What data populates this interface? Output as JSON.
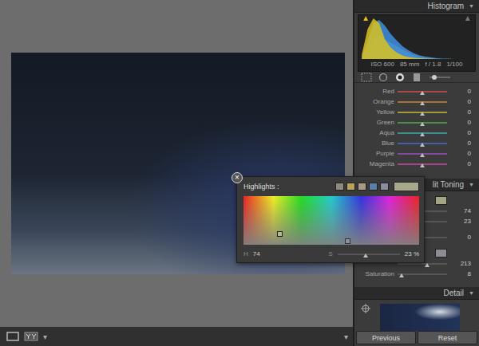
{
  "histogram": {
    "title": "Histogram",
    "toggle": "▼",
    "info": [
      "ISO 600",
      "85 mm",
      "f / 1.8",
      "1/100"
    ],
    "series": [
      {
        "name": "gray",
        "color": "#8e8e8e",
        "values": [
          2,
          22,
          52,
          58,
          48,
          40,
          32,
          24,
          16,
          10,
          6,
          4,
          2,
          1,
          0,
          0,
          0,
          0,
          0,
          0
        ]
      },
      {
        "name": "blue",
        "color": "#3d8fe0",
        "values": [
          6,
          45,
          88,
          96,
          82,
          62,
          46,
          32,
          22,
          14,
          9,
          6,
          4,
          2,
          1,
          1,
          0,
          0,
          0,
          0
        ]
      },
      {
        "name": "yellow",
        "color": "#d9c222",
        "values": [
          12,
          74,
          100,
          88,
          48,
          28,
          16,
          9,
          5,
          3,
          2,
          1,
          1,
          0,
          0,
          0,
          0,
          0,
          0,
          0
        ]
      }
    ]
  },
  "hsl": [
    {
      "label": "Red",
      "value": "0",
      "level": 0.5,
      "color": "#b84a4a"
    },
    {
      "label": "Orange",
      "value": "0",
      "level": 0.5,
      "color": "#b8793a"
    },
    {
      "label": "Yellow",
      "value": "0",
      "level": 0.5,
      "color": "#b0a43a"
    },
    {
      "label": "Green",
      "value": "0",
      "level": 0.5,
      "color": "#4e9a4a"
    },
    {
      "label": "Aqua",
      "value": "0",
      "level": 0.5,
      "color": "#3a9a9a"
    },
    {
      "label": "Blue",
      "value": "0",
      "level": 0.5,
      "color": "#4a62b8"
    },
    {
      "label": "Purple",
      "value": "0",
      "level": 0.5,
      "color": "#8a4ab0"
    },
    {
      "label": "Magenta",
      "value": "0",
      "level": 0.5,
      "color": "#b04a8e"
    }
  ],
  "split_toning": {
    "title": "lit Toning",
    "toggle": "▼",
    "rows": [
      {
        "kind": "swatch",
        "color": "#a5a586"
      },
      {
        "kind": "slider",
        "value": "74",
        "level": 0.21
      },
      {
        "kind": "slider",
        "value": "23",
        "level": 0.23
      },
      {
        "kind": "slider",
        "value": "0",
        "level": 0.5
      },
      {
        "kind": "swatch",
        "color": "#8c8c94"
      },
      {
        "kind": "slider",
        "value": "213",
        "level": 0.59
      },
      {
        "kind": "slider",
        "label": "Saturation",
        "value": "8",
        "level": 0.08
      }
    ]
  },
  "popup": {
    "title": "Highlights :",
    "close": "×",
    "swatches": [
      {
        "color": "#8d8c7c",
        "selected": false
      },
      {
        "color": "#b5a35e",
        "selected": false
      },
      {
        "color": "#a99a84",
        "selected": false
      },
      {
        "color": "#5d7eab",
        "selected": false
      },
      {
        "color": "#8b8ca2",
        "selected": false
      }
    ],
    "current_color": "#a8a88a",
    "markers": [
      {
        "hue_level": 0.205,
        "sat_level": 0.23,
        "selected": true
      },
      {
        "hue_level": 0.592,
        "sat_level": 0.08,
        "selected": false
      }
    ],
    "hue_label": "H",
    "hue_value": "74",
    "sat_label": "S",
    "sat_level": 0.45,
    "sat_value": "23 %"
  },
  "detail": {
    "title": "Detail",
    "toggle": "▼"
  },
  "toolbar": {
    "dropdown": "▾",
    "end": "▾"
  },
  "buttons": [
    {
      "label": "Previous"
    },
    {
      "label": "Reset"
    }
  ]
}
